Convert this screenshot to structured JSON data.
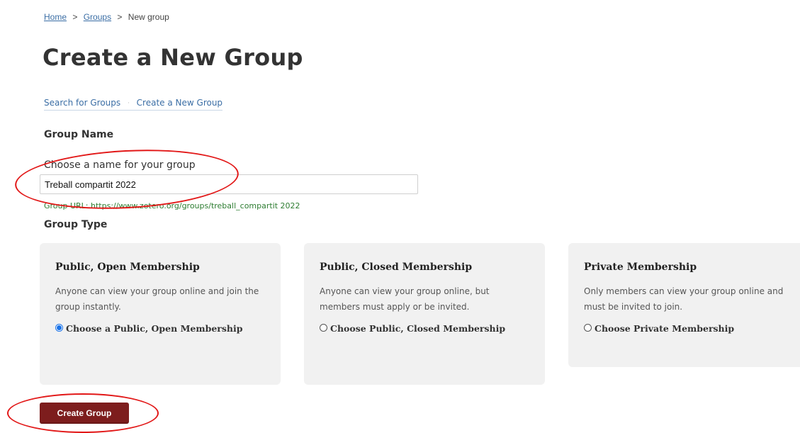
{
  "breadcrumb": {
    "home": "Home",
    "sep1": ">",
    "groups": "Groups",
    "sep2": ">",
    "current": "New group"
  },
  "page": {
    "title": "Create a New Group"
  },
  "subnav": {
    "search": "Search for Groups",
    "separator": "·",
    "create": "Create a New Group"
  },
  "form": {
    "group_name_heading": "Group Name",
    "name_label": "Choose a name for your group",
    "name_value": "Treball compartit 2022",
    "group_url": "Group URL: https://www.zotero.org/groups/treball_compartit 2022",
    "group_type_heading": "Group Type"
  },
  "group_types": [
    {
      "title": "Public, Open Membership",
      "description": "Anyone can view your group online and join the group instantly.",
      "choice": "Choose a Public, Open Membership",
      "selected": true
    },
    {
      "title": "Public, Closed Membership",
      "description": "Anyone can view your group online, but members must apply or be invited.",
      "choice": "Choose Public, Closed Membership",
      "selected": false
    },
    {
      "title": "Private Membership",
      "description": "Only members can view your group online and must be invited to join.",
      "choice": "Choose Private Membership",
      "selected": false
    }
  ],
  "actions": {
    "create_label": "Create Group"
  },
  "colors": {
    "link": "#3b6ea5",
    "url_text": "#2e7d32",
    "button_bg": "#7d1d1d",
    "annotation": "#e21818",
    "card_bg": "#f1f1f1"
  }
}
